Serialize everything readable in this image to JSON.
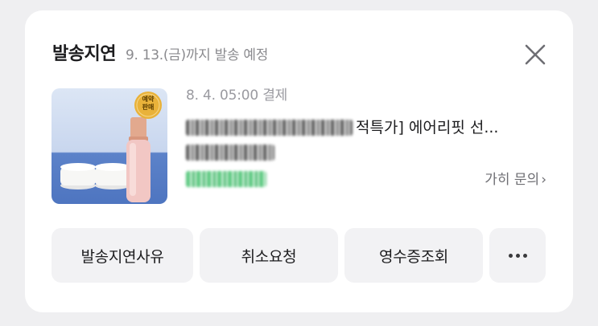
{
  "header": {
    "title": "발송지연",
    "subtitle": "9. 13.(금)까지 발송 예정",
    "close_icon": "close-icon"
  },
  "order": {
    "paid_text": "8. 4. 05:00 결제",
    "product_name_visible": "적특가] 에어리핏 선...",
    "badge_text": [
      "예약",
      "판매"
    ],
    "inquiry_label": "가히 문의",
    "inquiry_icon": "chevron-right-icon"
  },
  "actions": {
    "delay_reason": "발송지연사유",
    "cancel_request": "취소요청",
    "receipt": "영수증조회",
    "more_icon": "more-dots-icon"
  },
  "colors": {
    "background": "#efeff1",
    "card": "#ffffff",
    "button_bg": "#f2f2f4",
    "badge": "#e9b23a",
    "thumb_blue": "#4e75c0"
  }
}
